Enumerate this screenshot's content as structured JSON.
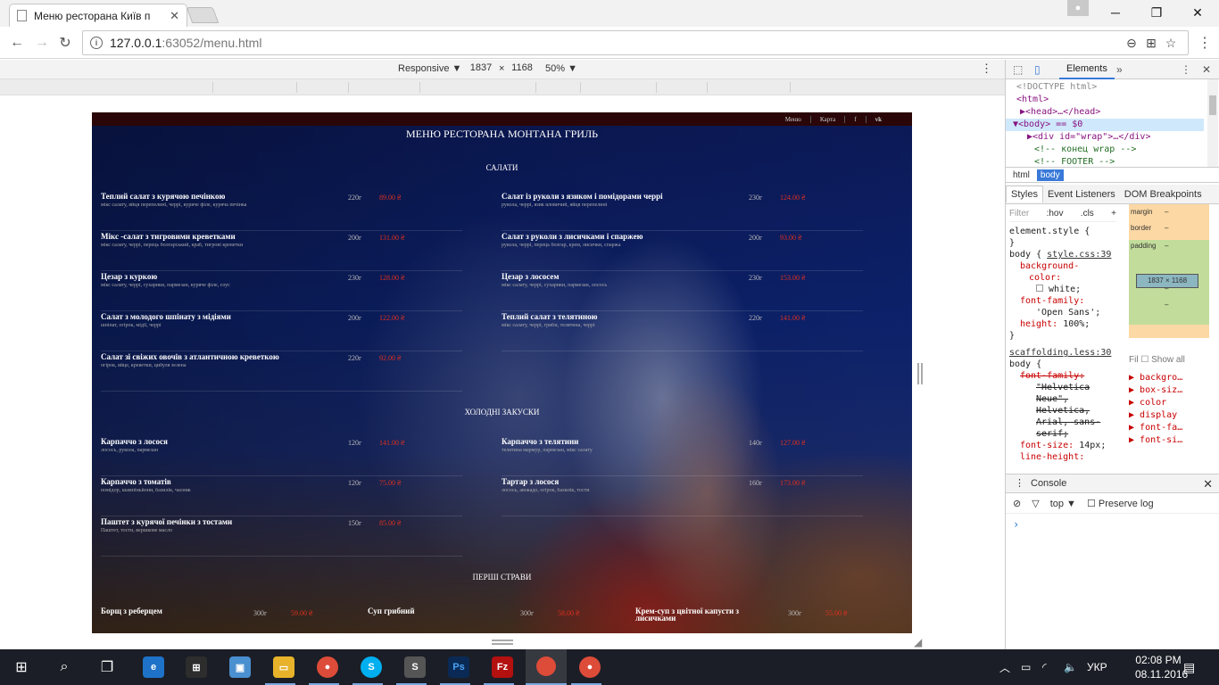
{
  "browser": {
    "tab_title": "Меню ресторана Київ п",
    "url_host": "127.0.0.1",
    "url_rest": ":63052/menu.html"
  },
  "device_toolbar": {
    "mode": "Responsive ▼",
    "width": "1837",
    "times": "×",
    "height": "1168",
    "zoom": "50% ▼"
  },
  "site": {
    "nav": [
      "Меню",
      "Карта",
      "f",
      "vk"
    ],
    "title": "МЕНЮ РЕСТОРАНА МОНТАНА ГРИЛЬ",
    "sections": {
      "salads": "САЛАТИ",
      "cold": "ХОЛОДНІ ЗАКУСКИ",
      "first": "ПЕРШІ СТРАВИ"
    },
    "salads": [
      {
        "name": "Теплий салат з курячою печінкою",
        "desc": "мікс салату, яйця перепелині, черрі, куряче філе, куряча печінка",
        "weight": "220г",
        "price": "89.00 ₴"
      },
      {
        "name": "Салат із руколи з язиком і помідорами черрі",
        "desc": "рукола, черрі, язик яловичий, яйця перепелині",
        "weight": "230г",
        "price": "124.00 ₴"
      },
      {
        "name": "Мікс -салат з тигровими креветками",
        "desc": "мікс салату, черрі, перець болгарський, краб, тигрові креветки",
        "weight": "200г",
        "price": "131.00 ₴"
      },
      {
        "name": "Салат з руколи з лисичками і спаржею",
        "desc": "рукола, черрі, перець болгар, крем, лисички, спаржа",
        "weight": "200г",
        "price": "93.00 ₴"
      },
      {
        "name": "Цезар з куркою",
        "desc": "мікс салату, черрі, сухарики, пармезан, куряче філе, соус",
        "weight": "230г",
        "price": "128.00 ₴"
      },
      {
        "name": "Цезар з лососем",
        "desc": "мікс салату, черрі, сухарики, пармезан, лосось",
        "weight": "230г",
        "price": "153.00 ₴"
      },
      {
        "name": "Салат з молодого шпінату з мідіями",
        "desc": "шпінат, огірок, мідії, черрі",
        "weight": "200г",
        "price": "122.00 ₴"
      },
      {
        "name": "Теплий салат з телятиною",
        "desc": "мікс салату, черрі, гриби, телятина, черрі",
        "weight": "220г",
        "price": "141.00 ₴"
      },
      {
        "name": "Салат зі свіжих овочів з атлантичною креветкою",
        "desc": "огірок, яйце, креветки, цибуля зелена",
        "weight": "220г",
        "price": "92.00 ₴"
      }
    ],
    "cold": [
      {
        "name": "Карпаччо з лосося",
        "desc": "лосось, рукола, пармезан",
        "weight": "120г",
        "price": "141.00 ₴"
      },
      {
        "name": "Карпаччо з телятини",
        "desc": "телятина мармур, пармезан, мікс салату",
        "weight": "140г",
        "price": "127.00 ₴"
      },
      {
        "name": "Карпаччо з томатів",
        "desc": "помідор, шампіньйони, базилік, часник",
        "weight": "120г",
        "price": "75.00 ₴"
      },
      {
        "name": "Тартар з лосося",
        "desc": "лосось, авокадо, огірок, базилік, тости",
        "weight": "160г",
        "price": "173.00 ₴"
      },
      {
        "name": "Паштет з курячої печінки з тостами",
        "desc": "Паштет, тости, вершкове масло",
        "weight": "150г",
        "price": "85.00 ₴"
      }
    ],
    "first": [
      {
        "name": "Борщ з реберцем",
        "weight": "300г",
        "price": "59.00 ₴"
      },
      {
        "name": "Суп грибний",
        "weight": "300г",
        "price": "58.00 ₴"
      },
      {
        "name": "Крем-суп з цвітної капусти з лисичками",
        "weight": "300г",
        "price": "55.00 ₴"
      }
    ]
  },
  "devtools": {
    "tab_elements": "Elements",
    "dom": [
      "<!DOCTYPE html>",
      "<html>",
      "▶<head>…</head>",
      "▼<body> == $0",
      "▶<div id=\"wrap\">…</div>",
      "<!-- конец wrap -->",
      "<!-- FOOTER -->"
    ],
    "crumbs": [
      "html",
      "body"
    ],
    "style_tabs": [
      "Styles",
      "Event Listeners",
      "DOM Breakpoints"
    ],
    "filter": "Filter",
    "hov": ":hov",
    "cls": ".cls",
    "rules": {
      "element_style": "element.style {",
      "close": "}",
      "body_open": "body {",
      "style_src": "style.css:39",
      "bg_prop": "background-",
      "bg_prop2": "color:",
      "bg_val": "white;",
      "ff_prop": "font-family:",
      "ff_val": "'Open Sans';",
      "h_prop": "height:",
      "h_val": "100%;",
      "scaff_src": "scaffolding.less:30",
      "scaff_body": "body {",
      "s_ff": "font-family:",
      "s_ff_v1": "\"Helvetica",
      "s_ff_v2": "Neue\",",
      "s_ff_v3": "Helvetica,",
      "s_ff_v4": "Arial, sans-",
      "s_ff_v5": "serif;",
      "s_fs": "font-size:",
      "s_fs_v": "14px;",
      "s_lh": "line-height:"
    },
    "box_model": {
      "margin": "margin",
      "border": "border",
      "padding": "padding",
      "content": "1837 × 1168",
      "dash": "–"
    },
    "computed_filter": "Fil",
    "show_all": "Show all",
    "computed": [
      "backgro…",
      "box-siz…",
      "color",
      "display",
      "font-fa…",
      "font-si…"
    ],
    "console_title": "Console",
    "console_context": "top",
    "preserve_log": "Preserve log"
  },
  "taskbar": {
    "lang": "УКР",
    "time": "02:08 PM",
    "date": "08.11.2016"
  }
}
